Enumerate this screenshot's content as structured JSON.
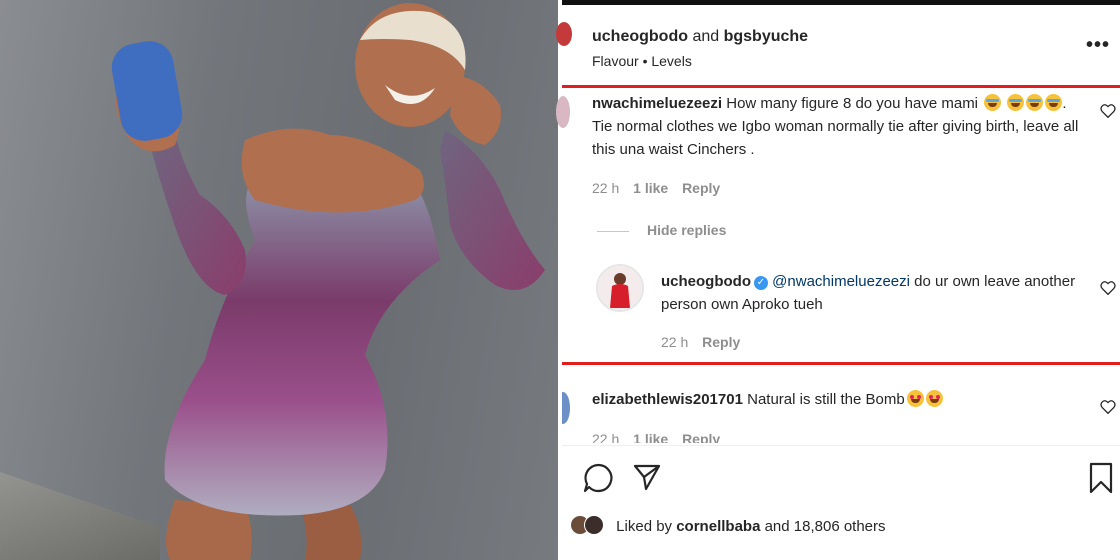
{
  "header": {
    "user1": "ucheogbodo",
    "joiner": "and",
    "user2": "bgsbyuche",
    "subtitle": "Flavour • Levels",
    "more_label": "•••"
  },
  "comments": [
    {
      "username": "nwachimeluezeezi",
      "text_part1": "How many figure 8 do you have mami",
      "text_part2": ". Tie normal clothes we Igbo woman normally tie after giving birth, leave all this una waist Cinchers .",
      "time": "22 h",
      "likes": "1 like",
      "reply": "Reply"
    },
    {
      "username": "elizabethlewis201701",
      "text": "Natural is still the Bomb",
      "time": "22 h",
      "likes": "1 like",
      "reply": "Reply"
    }
  ],
  "hide_replies": "Hide replies",
  "reply": {
    "username": "ucheogbodo",
    "mention": "@nwachimeluezeezi",
    "text": "do ur own leave another person own Aproko tueh",
    "time": "22 h",
    "reply_label": "Reply"
  },
  "footer": {
    "liked_by_prefix": "Liked by",
    "liked_by_user": "cornellbaba",
    "liked_by_suffix": "and 18,806 others"
  },
  "icons": {
    "comment": "comment-icon",
    "share": "share-icon",
    "bookmark": "bookmark-icon",
    "heart": "heart-icon",
    "verified": "verified-badge-icon",
    "more": "more-icon"
  },
  "colors": {
    "highlight_line": "#e01e1e",
    "mention": "#00376b",
    "verified": "#3897f0",
    "muted": "#8e8e8e"
  }
}
